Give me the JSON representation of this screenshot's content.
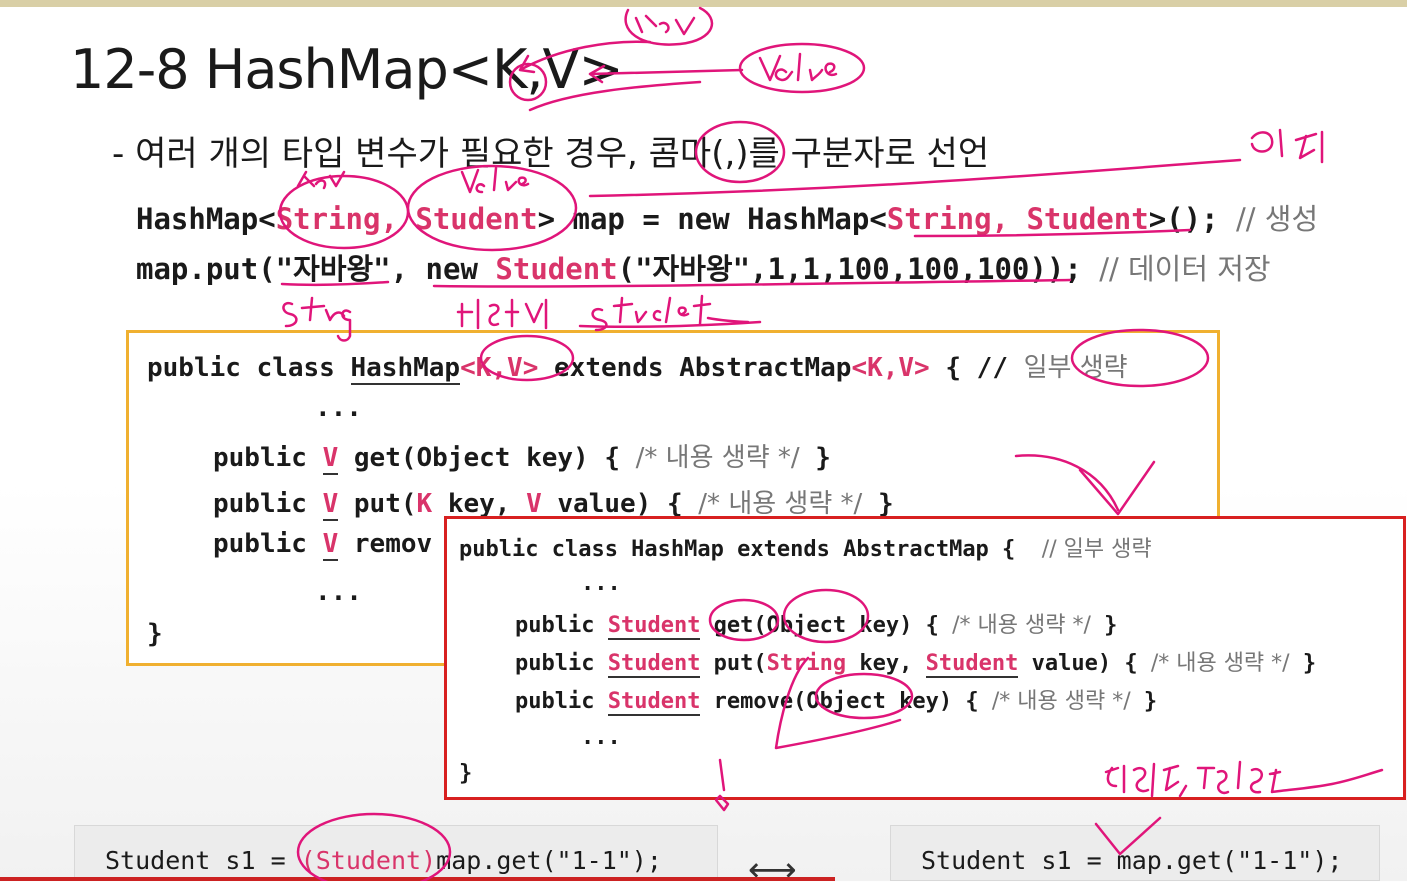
{
  "slide": {
    "title": "12-8 HashMap<K,V>",
    "subtitle": "- 여러 개의 타입 변수가 필요한 경우, 콤마(,)를 구분자로 선언"
  },
  "code_top": {
    "l1": [
      "HashMap<",
      "String, Student",
      "> map = new HashMap<",
      "String, Student",
      ">(); ",
      "// 생성"
    ],
    "l2": [
      "map.put(\"자바왕\", new ",
      "Student",
      "(\"자바왕\",1,1,100,100,100)); ",
      "// 데이터 저장"
    ]
  },
  "generic_box": {
    "l1": [
      "public class ",
      "HashMap",
      "<K,V>",
      " extends AbstractMap",
      "<K,V>",
      " { // ",
      "일부 생략"
    ],
    "l2": "...",
    "l3": [
      "public ",
      "V",
      " get(Object key) { ",
      "/* 내용 생략 */",
      " }"
    ],
    "l4": [
      "public ",
      "V",
      " put(",
      "K",
      " key, ",
      "V",
      " value) { ",
      "/* 내용 생략 */",
      " }"
    ],
    "l5": [
      "public ",
      "V",
      " remov"
    ],
    "l6": "...",
    "l7": "}"
  },
  "concrete_box": {
    "l1": [
      "public class HashMap extends AbstractMap {  ",
      "// 일부 생략"
    ],
    "l2": "...",
    "l3": [
      "public ",
      "Student",
      " get(Object key) { ",
      "/* 내용 생략 */",
      " }"
    ],
    "l4": [
      "public ",
      "Student",
      " put(",
      "String",
      " key, ",
      "Student",
      " value) { ",
      "/* 내용 생략 */",
      " }"
    ],
    "l5": [
      "public ",
      "Student",
      " remove(Object key) { ",
      "/* 내용 생략 */",
      " }"
    ],
    "l6": "...",
    "l7": "}"
  },
  "bottom": {
    "left": [
      "Student s1 = ",
      "(Student)",
      "map.get(\"1-1\");"
    ],
    "arrow": "⟷",
    "right": "Student s1 = map.get(\"1-1\");"
  },
  "colors": {
    "accent": "#d9346a",
    "ink": "#e0157a",
    "yellow_border": "#f0b030",
    "red_border": "#d82020"
  }
}
